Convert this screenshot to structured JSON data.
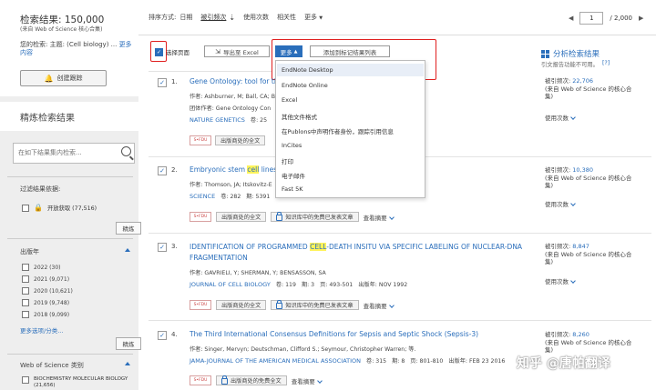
{
  "sidebar": {
    "results_title": "检索结果: 150,000",
    "results_source": "(来自 Web of Science 核心合集)",
    "saved_text": "您的检索: 主题: (Cell biology) ...",
    "saved_more": "更多内容",
    "create_alert": "创建跟踪",
    "refine_title": "精炼检索结果",
    "search_placeholder": "在如下结果集内检索...",
    "filter_label": "过滤结果依据:",
    "open_access": "开放获取 (77,516)",
    "refine_button": "精炼",
    "pub_year_title": "出版年",
    "years": [
      "2022 (30)",
      "2021 (9,071)",
      "2020 (10,621)",
      "2019 (9,748)",
      "2018 (9,099)"
    ],
    "more_options": "更多选项/分类...",
    "wos_category_title": "Web of Science 类别",
    "wos_category_item": "BIOCHEMISTRY MOLECULAR BIOLOGY (21,656)"
  },
  "topbar": {
    "sort_label": "排序方式:",
    "sort_options": [
      "日期",
      "被引频次",
      "使用次数",
      "相关性",
      "更多"
    ],
    "sort_active_index": 1,
    "page_current": "1",
    "page_total": "/ 2,000"
  },
  "toolbar": {
    "select_page": "选择页面",
    "export_excel": "导出至 Excel",
    "more": "更多",
    "add_marked": "添加到标记结果列表"
  },
  "analysis": {
    "title": "分析检索结果",
    "note": "引文报告功能不可用。",
    "help": "[?]"
  },
  "dropdown": {
    "items": [
      "EndNote Desktop",
      "EndNote Online",
      "Excel",
      "其他文件格式",
      "在Publons中声明作者身份，跟踪引用信息",
      "InCites",
      "打印",
      "电子邮件",
      "Fast 5K"
    ],
    "highlighted_index": 0
  },
  "records": [
    {
      "num": "1.",
      "title": "Gene Ontology: tool for the",
      "authors": "作者: Ashburner, M; Ball, CA; B",
      "group": "团体作者: Gene Ontology Con",
      "journal": "NATURE GENETICS",
      "volume": "卷: 25",
      "cites_label": "被引频次:",
      "cites": "22,706",
      "cites_source": "(来自 Web of Science 的核心合集)",
      "usage": "使用次数",
      "publisher_fulltext": "出版商处的全文"
    },
    {
      "num": "2.",
      "title_before": "Embryonic stem",
      "title_hl": "cell",
      "title_after": "lines d",
      "authors": "作者: Thomson, JA; Itskovitz-E",
      "journal": "SCIENCE",
      "volume": "卷: 282",
      "issue": "期: 5391",
      "cites_label": "被引频次:",
      "cites": "10,380",
      "cites_source": "(来自 Web of Science 的核心合集)",
      "usage": "使用次数",
      "publisher_fulltext": "出版商处的全文",
      "free_fulltext": "知识库中的免费已发表文章",
      "view_summary": "查看摘要"
    },
    {
      "num": "3.",
      "title_before": "IDENTIFICATION OF PROGRAMMED",
      "title_hl": "CELL",
      "title_after": "-DEATH INSITU VIA SPECIFIC LABELING OF NUCLEAR-DNA",
      "title_line2": "FRAGMENTATION",
      "authors": "作者: GAVRIELI, Y; SHERMAN, Y; BENSASSON, SA",
      "journal": "JOURNAL OF CELL BIOLOGY",
      "volume": "卷: 119",
      "issue": "期: 3",
      "pages": "页: 493-501",
      "date": "出版年: NOV 1992",
      "cites_label": "被引频次:",
      "cites": "8,847",
      "cites_source": "(来自 Web of Science 的核心合集)",
      "usage": "使用次数",
      "publisher_fulltext": "出版商处的全文",
      "free_fulltext": "知识库中的免费已发表文章",
      "view_summary": "查看摘要"
    },
    {
      "num": "4.",
      "title": "The Third International Consensus Definitions for Sepsis and Septic Shock (Sepsis-3)",
      "authors": "作者: Singer, Mervyn; Deutschman, Clifford S.; Seymour, Christopher Warren; 等.",
      "journal": "JAMA-JOURNAL OF THE AMERICAN MEDICAL ASSOCIATION",
      "volume": "卷: 315",
      "issue": "期: 8",
      "pages": "页: 801-810",
      "date": "出版年: FEB 23 2016",
      "cites_label": "被引频次:",
      "cites": "8,260",
      "cites_source": "(来自 Web of Science 的核心合集)",
      "publisher_fulltext": "出版商处的免费全文",
      "view_summary": "查看摘要"
    }
  ],
  "sfx_label": "S•FDU",
  "watermark": "知乎 @唐帕翻译",
  "colors": {
    "accent": "#2a6ebb",
    "highlight_box": "#e02020",
    "cell_highlight": "#fff35a"
  }
}
